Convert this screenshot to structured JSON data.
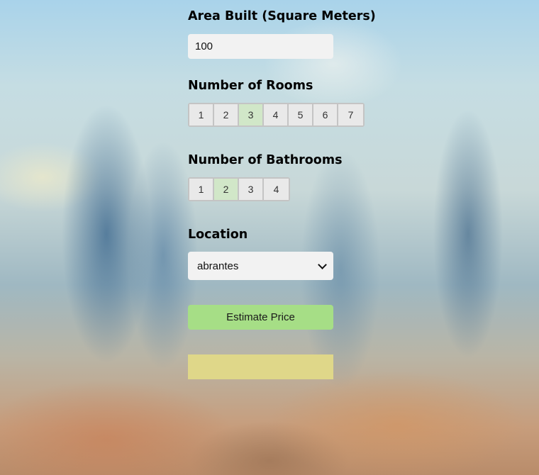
{
  "area": {
    "label": "Area Built (Square Meters)",
    "value": "100"
  },
  "rooms": {
    "label": "Number of Rooms",
    "options": [
      "1",
      "2",
      "3",
      "4",
      "5",
      "6",
      "7"
    ],
    "selected": "3"
  },
  "bathrooms": {
    "label": "Number of Bathrooms",
    "options": [
      "1",
      "2",
      "3",
      "4"
    ],
    "selected": "2"
  },
  "location": {
    "label": "Location",
    "selected": "abrantes"
  },
  "estimate_button": {
    "label": "Estimate Price"
  },
  "result": {
    "text": ""
  },
  "colors": {
    "selected_option": "#d1e7c8",
    "button": "#a6de86",
    "result_box": "#dfd789",
    "input_bg": "#f2f2f2"
  }
}
